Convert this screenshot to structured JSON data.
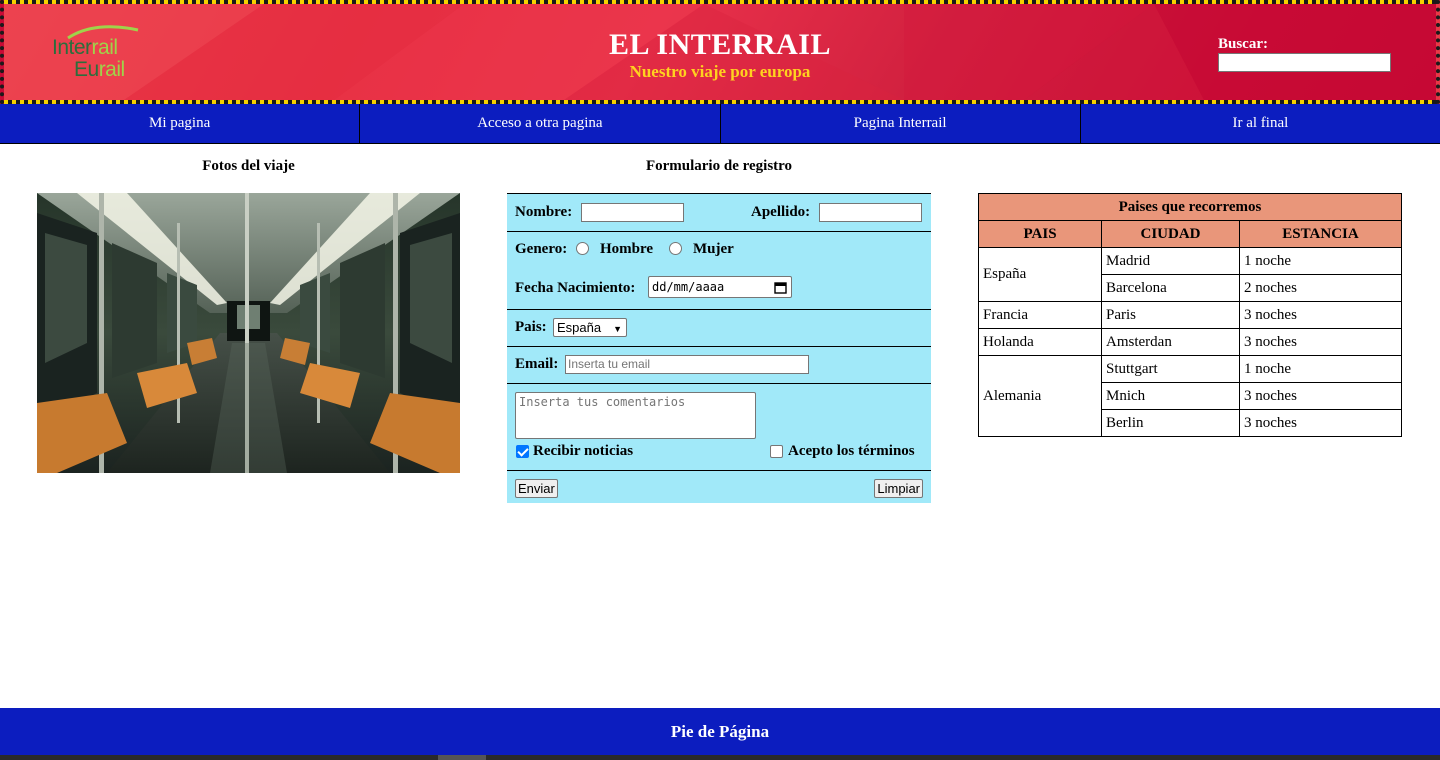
{
  "header": {
    "logo": {
      "line1_dark": "Inter",
      "line1_light": "rail",
      "line2_dark": "Eu",
      "line2_light": "rail"
    },
    "title": "EL INTERRAIL",
    "subtitle": "Nuestro viaje por europa",
    "search_label": "Buscar:",
    "search_value": "",
    "colors": {
      "subtitle": "#ffd21f",
      "background": "#e42a3f"
    }
  },
  "nav": {
    "items": [
      {
        "label": "Mi pagina"
      },
      {
        "label": "Acceso a otra pagina"
      },
      {
        "label": "Pagina Interrail"
      },
      {
        "label": "Ir al final"
      }
    ],
    "color": "#0c1dbf"
  },
  "photos": {
    "title": "Fotos del viaje"
  },
  "form": {
    "title": "Formulario de registro",
    "nombre_label": "Nombre:",
    "apellido_label": "Apellido:",
    "genero_label": "Genero:",
    "genero_options": [
      "Hombre",
      "Mujer"
    ],
    "fecha_label": "Fecha Nacimiento:",
    "fecha_placeholder": "dd/mm/aaaa",
    "pais_label": "Pais:",
    "pais_selected": "España",
    "email_label": "Email:",
    "email_placeholder": "Inserta tu email",
    "comments_placeholder": "Inserta tus comentarios",
    "recibir_label": "Recibir noticias",
    "recibir_checked": true,
    "acepto_label": "Acepto los términos",
    "acepto_checked": false,
    "enviar_label": "Enviar",
    "limpiar_label": "Limpiar",
    "background": "#a1e9f9"
  },
  "table": {
    "caption": "Paises que recorremos",
    "headers": [
      "PAIS",
      "CIUDAD",
      "ESTANCIA"
    ],
    "rows": [
      {
        "country": "España",
        "city": "Madrid",
        "stay": "1 noche"
      },
      {
        "city": "Barcelona",
        "stay": "2 noches"
      },
      {
        "country": "Francia",
        "city": "Paris",
        "stay": "3 noches"
      },
      {
        "country": "Holanda",
        "city": "Amsterdan",
        "stay": "3 noches"
      },
      {
        "country": "Alemania",
        "city": "Stuttgart",
        "stay": "1 noche"
      },
      {
        "city": "Mnich",
        "stay": "3 noches"
      },
      {
        "city": "Berlin",
        "stay": "3 noches"
      }
    ],
    "header_color": "#e9967a"
  },
  "footer": {
    "text": "Pie de Página"
  }
}
